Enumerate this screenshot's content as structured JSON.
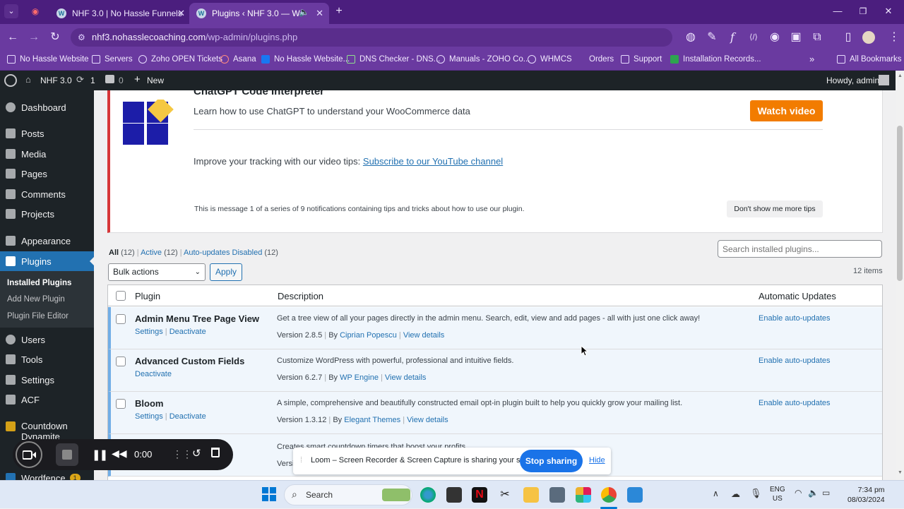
{
  "browser": {
    "tabs": [
      {
        "title": "NHF 3.0 | No Hassle Funnels",
        "active": false
      },
      {
        "title": "Plugins ‹ NHF 3.0 — WordP",
        "active": true
      }
    ],
    "url_host": "nhf3.nohasslecoaching.com",
    "url_path": "/wp-admin/plugins.php",
    "bookmarks": [
      "No Hassle Website",
      "Servers",
      "Zoho OPEN Tickets",
      "Asana",
      "No Hassle Website...",
      "DNS Checker - DNS...",
      "Manuals - ZOHO Co...",
      "WHMCS",
      "Orders",
      "Support",
      "Installation Records..."
    ],
    "all_bookmarks": "All Bookmarks"
  },
  "adminbar": {
    "site": "NHF 3.0",
    "updates": "1",
    "comments": "0",
    "new": "New",
    "howdy": "Howdy, admin"
  },
  "sidebar": {
    "items": [
      {
        "label": "Dashboard"
      },
      {
        "label": "Posts"
      },
      {
        "label": "Media"
      },
      {
        "label": "Pages"
      },
      {
        "label": "Comments"
      },
      {
        "label": "Projects"
      },
      {
        "label": "Appearance"
      },
      {
        "label": "Plugins"
      },
      {
        "label": "Users"
      },
      {
        "label": "Tools"
      },
      {
        "label": "Settings"
      },
      {
        "label": "ACF"
      },
      {
        "label": "Countdown Dynamite"
      },
      {
        "label": "Wordfence",
        "badge": "1"
      }
    ],
    "submenu": [
      "Installed Plugins",
      "Add New Plugin",
      "Plugin File Editor"
    ]
  },
  "notice": {
    "heading": "ChatGPT Code Interpreter",
    "text": "Learn how to use ChatGPT to understand your WooCommerce data",
    "watch_button": "Watch video",
    "tips_prefix": "Improve your tracking with our video tips:",
    "tips_link": "Subscribe to our YouTube channel",
    "series_text": "This is message 1 of a series of 9 notifications containing tips and tricks about how to use our plugin.",
    "dismiss": "Don't show me more tips"
  },
  "filters": {
    "all": "All",
    "all_count": "(12)",
    "active": "Active",
    "active_count": "(12)",
    "auto": "Auto-updates Disabled",
    "auto_count": "(12)"
  },
  "search_placeholder": "Search installed plugins...",
  "bulk": {
    "selected": "Bulk actions",
    "apply": "Apply"
  },
  "items_count": "12 items",
  "table": {
    "headers": {
      "plugin": "Plugin",
      "description": "Description",
      "auto": "Automatic Updates"
    },
    "rows": [
      {
        "name": "Admin Menu Tree Page View",
        "actions": [
          "Settings",
          "Deactivate"
        ],
        "desc": "Get a tree view of all your pages directly in the admin menu. Search, edit, view and add pages - all with just one click away!",
        "version": "Version 2.8.5",
        "by": "By",
        "author": "Ciprian Popescu",
        "details": "View details",
        "auto": "Enable auto-updates"
      },
      {
        "name": "Advanced Custom Fields",
        "actions": [
          "Deactivate"
        ],
        "desc": "Customize WordPress with powerful, professional and intuitive fields.",
        "version": "Version 6.2.7",
        "by": "By",
        "author": "WP Engine",
        "details": "View details",
        "auto": "Enable auto-updates"
      },
      {
        "name": "Bloom",
        "actions": [
          "Settings",
          "Deactivate"
        ],
        "desc": "A simple, comprehensive and beautifully constructed email opt-in plugin built to help you quickly grow your mailing list.",
        "version": "Version 1.3.12",
        "by": "By",
        "author": "Elegant Themes",
        "details": "View details",
        "auto": "Enable auto-updates"
      },
      {
        "name": "",
        "actions": [],
        "desc": "Creates smart countdown timers that boost your profits.",
        "version": "Versi",
        "by": "",
        "author": "",
        "details": "",
        "auto": ""
      }
    ]
  },
  "loom": {
    "timer": "0:00",
    "message": "Loom – Screen Recorder & Screen Capture is sharing your screen.",
    "stop": "Stop sharing",
    "hide": "Hide"
  },
  "taskbar": {
    "search": "Search",
    "lang1": "ENG",
    "lang2": "US",
    "time": "7:34 pm",
    "date": "08/03/2024"
  }
}
